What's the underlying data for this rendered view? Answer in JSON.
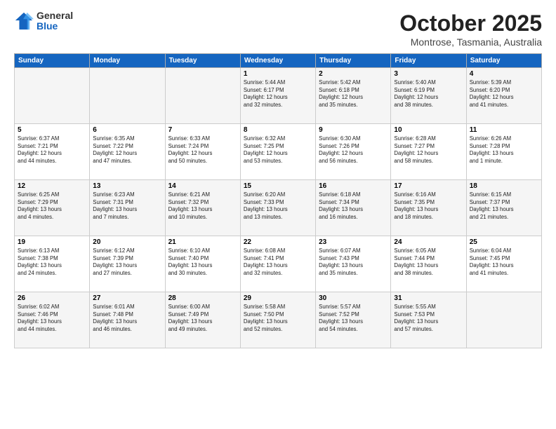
{
  "header": {
    "logo": {
      "general": "General",
      "blue": "Blue"
    },
    "title": "October 2025",
    "subtitle": "Montrose, Tasmania, Australia"
  },
  "days_of_week": [
    "Sunday",
    "Monday",
    "Tuesday",
    "Wednesday",
    "Thursday",
    "Friday",
    "Saturday"
  ],
  "weeks": [
    [
      {
        "day": "",
        "info": ""
      },
      {
        "day": "",
        "info": ""
      },
      {
        "day": "",
        "info": ""
      },
      {
        "day": "1",
        "info": "Sunrise: 5:44 AM\nSunset: 6:17 PM\nDaylight: 12 hours\nand 32 minutes."
      },
      {
        "day": "2",
        "info": "Sunrise: 5:42 AM\nSunset: 6:18 PM\nDaylight: 12 hours\nand 35 minutes."
      },
      {
        "day": "3",
        "info": "Sunrise: 5:40 AM\nSunset: 6:19 PM\nDaylight: 12 hours\nand 38 minutes."
      },
      {
        "day": "4",
        "info": "Sunrise: 5:39 AM\nSunset: 6:20 PM\nDaylight: 12 hours\nand 41 minutes."
      }
    ],
    [
      {
        "day": "5",
        "info": "Sunrise: 6:37 AM\nSunset: 7:21 PM\nDaylight: 12 hours\nand 44 minutes."
      },
      {
        "day": "6",
        "info": "Sunrise: 6:35 AM\nSunset: 7:22 PM\nDaylight: 12 hours\nand 47 minutes."
      },
      {
        "day": "7",
        "info": "Sunrise: 6:33 AM\nSunset: 7:24 PM\nDaylight: 12 hours\nand 50 minutes."
      },
      {
        "day": "8",
        "info": "Sunrise: 6:32 AM\nSunset: 7:25 PM\nDaylight: 12 hours\nand 53 minutes."
      },
      {
        "day": "9",
        "info": "Sunrise: 6:30 AM\nSunset: 7:26 PM\nDaylight: 12 hours\nand 56 minutes."
      },
      {
        "day": "10",
        "info": "Sunrise: 6:28 AM\nSunset: 7:27 PM\nDaylight: 12 hours\nand 58 minutes."
      },
      {
        "day": "11",
        "info": "Sunrise: 6:26 AM\nSunset: 7:28 PM\nDaylight: 13 hours\nand 1 minute."
      }
    ],
    [
      {
        "day": "12",
        "info": "Sunrise: 6:25 AM\nSunset: 7:29 PM\nDaylight: 13 hours\nand 4 minutes."
      },
      {
        "day": "13",
        "info": "Sunrise: 6:23 AM\nSunset: 7:31 PM\nDaylight: 13 hours\nand 7 minutes."
      },
      {
        "day": "14",
        "info": "Sunrise: 6:21 AM\nSunset: 7:32 PM\nDaylight: 13 hours\nand 10 minutes."
      },
      {
        "day": "15",
        "info": "Sunrise: 6:20 AM\nSunset: 7:33 PM\nDaylight: 13 hours\nand 13 minutes."
      },
      {
        "day": "16",
        "info": "Sunrise: 6:18 AM\nSunset: 7:34 PM\nDaylight: 13 hours\nand 16 minutes."
      },
      {
        "day": "17",
        "info": "Sunrise: 6:16 AM\nSunset: 7:35 PM\nDaylight: 13 hours\nand 18 minutes."
      },
      {
        "day": "18",
        "info": "Sunrise: 6:15 AM\nSunset: 7:37 PM\nDaylight: 13 hours\nand 21 minutes."
      }
    ],
    [
      {
        "day": "19",
        "info": "Sunrise: 6:13 AM\nSunset: 7:38 PM\nDaylight: 13 hours\nand 24 minutes."
      },
      {
        "day": "20",
        "info": "Sunrise: 6:12 AM\nSunset: 7:39 PM\nDaylight: 13 hours\nand 27 minutes."
      },
      {
        "day": "21",
        "info": "Sunrise: 6:10 AM\nSunset: 7:40 PM\nDaylight: 13 hours\nand 30 minutes."
      },
      {
        "day": "22",
        "info": "Sunrise: 6:08 AM\nSunset: 7:41 PM\nDaylight: 13 hours\nand 32 minutes."
      },
      {
        "day": "23",
        "info": "Sunrise: 6:07 AM\nSunset: 7:43 PM\nDaylight: 13 hours\nand 35 minutes."
      },
      {
        "day": "24",
        "info": "Sunrise: 6:05 AM\nSunset: 7:44 PM\nDaylight: 13 hours\nand 38 minutes."
      },
      {
        "day": "25",
        "info": "Sunrise: 6:04 AM\nSunset: 7:45 PM\nDaylight: 13 hours\nand 41 minutes."
      }
    ],
    [
      {
        "day": "26",
        "info": "Sunrise: 6:02 AM\nSunset: 7:46 PM\nDaylight: 13 hours\nand 44 minutes."
      },
      {
        "day": "27",
        "info": "Sunrise: 6:01 AM\nSunset: 7:48 PM\nDaylight: 13 hours\nand 46 minutes."
      },
      {
        "day": "28",
        "info": "Sunrise: 6:00 AM\nSunset: 7:49 PM\nDaylight: 13 hours\nand 49 minutes."
      },
      {
        "day": "29",
        "info": "Sunrise: 5:58 AM\nSunset: 7:50 PM\nDaylight: 13 hours\nand 52 minutes."
      },
      {
        "day": "30",
        "info": "Sunrise: 5:57 AM\nSunset: 7:52 PM\nDaylight: 13 hours\nand 54 minutes."
      },
      {
        "day": "31",
        "info": "Sunrise: 5:55 AM\nSunset: 7:53 PM\nDaylight: 13 hours\nand 57 minutes."
      },
      {
        "day": "",
        "info": ""
      }
    ]
  ]
}
